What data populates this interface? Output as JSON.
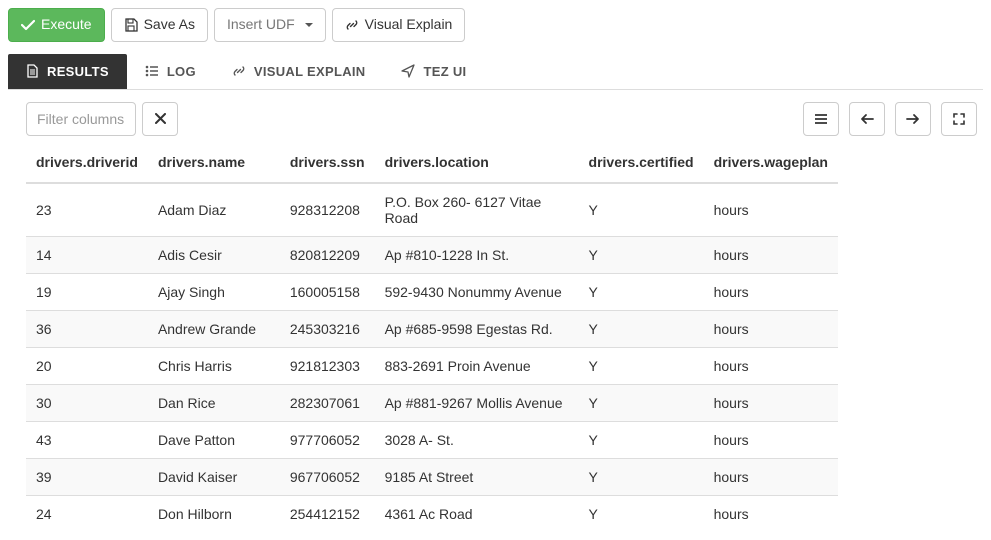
{
  "toolbar": {
    "execute_label": "Execute",
    "save_as_label": "Save As",
    "insert_udf_label": "Insert UDF",
    "visual_explain_label": "Visual Explain"
  },
  "tabs": {
    "results": "RESULTS",
    "log": "LOG",
    "visual_explain": "VISUAL EXPLAIN",
    "tez_ui": "TEZ UI"
  },
  "filter": {
    "placeholder": "Filter columns"
  },
  "table": {
    "headers": {
      "driverid": "drivers.driverid",
      "name": "drivers.name",
      "ssn": "drivers.ssn",
      "location": "drivers.location",
      "certified": "drivers.certified",
      "wageplan": "drivers.wageplan"
    },
    "rows": [
      {
        "driverid": "23",
        "name": "Adam Diaz",
        "ssn": "928312208",
        "location": "P.O. Box 260- 6127 Vitae Road",
        "certified": "Y",
        "wageplan": "hours"
      },
      {
        "driverid": "14",
        "name": "Adis Cesir",
        "ssn": "820812209",
        "location": "Ap #810-1228 In St.",
        "certified": "Y",
        "wageplan": "hours"
      },
      {
        "driverid": "19",
        "name": "Ajay Singh",
        "ssn": "160005158",
        "location": "592-9430 Nonummy Avenue",
        "certified": "Y",
        "wageplan": "hours"
      },
      {
        "driverid": "36",
        "name": "Andrew Grande",
        "ssn": "245303216",
        "location": "Ap #685-9598 Egestas Rd.",
        "certified": "Y",
        "wageplan": "hours"
      },
      {
        "driverid": "20",
        "name": "Chris Harris",
        "ssn": "921812303",
        "location": "883-2691 Proin Avenue",
        "certified": "Y",
        "wageplan": "hours"
      },
      {
        "driverid": "30",
        "name": "Dan Rice",
        "ssn": "282307061",
        "location": "Ap #881-9267 Mollis Avenue",
        "certified": "Y",
        "wageplan": "hours"
      },
      {
        "driverid": "43",
        "name": "Dave Patton",
        "ssn": "977706052",
        "location": "3028 A- St.",
        "certified": "Y",
        "wageplan": "hours"
      },
      {
        "driverid": "39",
        "name": "David Kaiser",
        "ssn": "967706052",
        "location": "9185 At Street",
        "certified": "Y",
        "wageplan": "hours"
      },
      {
        "driverid": "24",
        "name": "Don Hilborn",
        "ssn": "254412152",
        "location": "4361 Ac Road",
        "certified": "Y",
        "wageplan": "hours"
      }
    ]
  }
}
